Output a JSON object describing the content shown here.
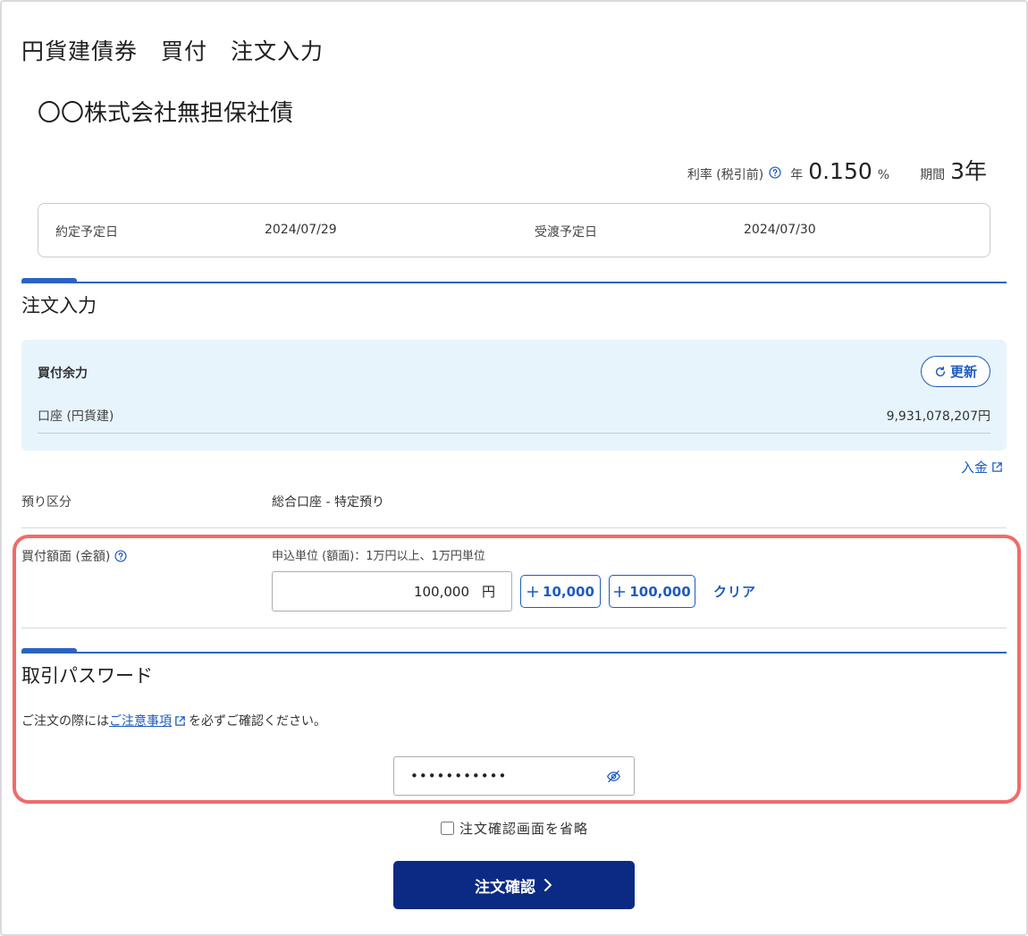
{
  "header": {
    "title": "円貨建債券　買付　注文入力"
  },
  "bond": {
    "name": "〇〇株式会社無担保社債"
  },
  "rate": {
    "label": "利率 (税引前)",
    "help_icon": "question-circle-icon",
    "prefix": "年",
    "value": "0.150",
    "unit": "%",
    "term_label": "期間",
    "term_value": "3年"
  },
  "dates": {
    "trade_label": "約定予定日",
    "trade_value": "2024/07/29",
    "settle_label": "受渡予定日",
    "settle_value": "2024/07/30"
  },
  "order_section": {
    "title": "注文入力"
  },
  "buying_power": {
    "title": "買付余力",
    "refresh_label": "更新",
    "refresh_icon": "refresh-icon",
    "account_label": "口座 (円貨建)",
    "account_value": "9,931,078,207円"
  },
  "deposit": {
    "label": "入金",
    "icon": "external-link-icon"
  },
  "custody": {
    "label": "預り区分",
    "value": "総合口座 - 特定預り"
  },
  "amount": {
    "label": "買付額面 (金額)",
    "unit_note": "申込単位 (額面)：1万円以上、1万円単位",
    "value": "100,000",
    "currency": "円",
    "inc1_label": "10,000",
    "inc2_label": "100,000",
    "clear_label": "クリア"
  },
  "password_section": {
    "title": "取引パスワード",
    "notice_before": "ご注文の際には",
    "notice_link": "ご注意事項",
    "notice_after": "を必ずご確認ください。",
    "value": "•••••••••••",
    "eye_icon": "eye-off-icon"
  },
  "skip_confirm": {
    "label": "注文確認画面を省略",
    "checked": false
  },
  "confirm_button": {
    "label": "注文確認"
  },
  "colors": {
    "primary": "#1d5bbf",
    "navy_button": "#0a2a84",
    "highlight_border": "#f06b6b",
    "info_bg": "#e8f4fc"
  }
}
